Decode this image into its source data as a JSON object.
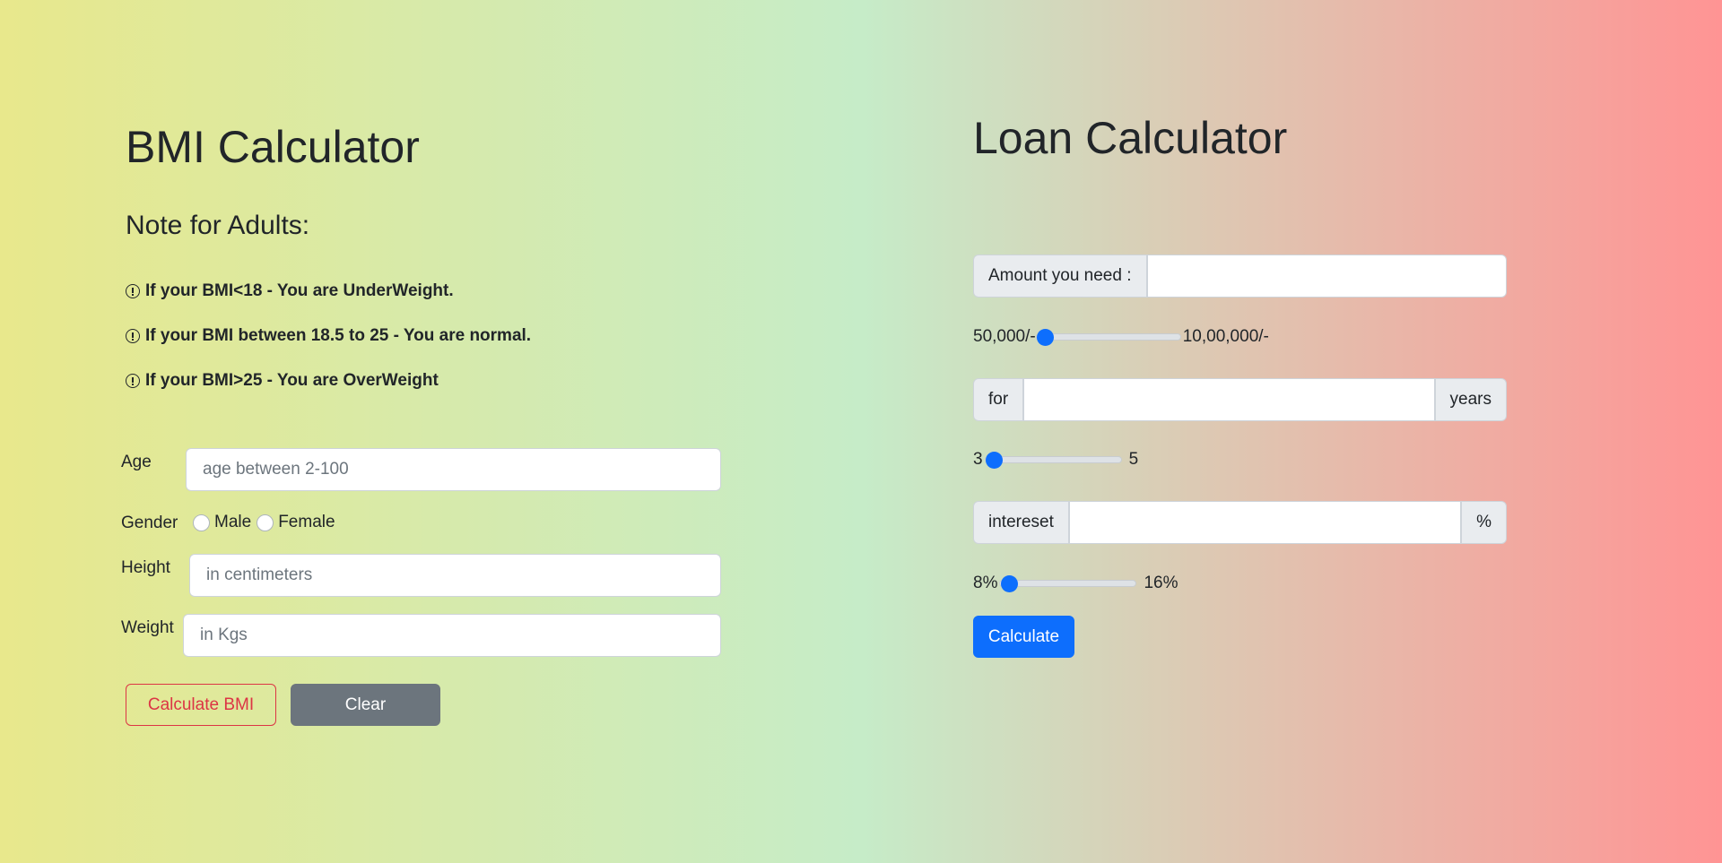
{
  "bmi": {
    "title": "BMI Calculator",
    "note_heading": "Note for Adults:",
    "notes": [
      "If your BMI<18 - You are UnderWeight.",
      "If your BMI between 18.5 to 25 - You are normal.",
      "If your BMI>25 - You are OverWeight"
    ],
    "age_label": "Age",
    "age_placeholder": "age between 2-100",
    "gender_label": "Gender",
    "gender_options": [
      "Male",
      "Female"
    ],
    "height_label": "Height",
    "height_placeholder": "in centimeters",
    "weight_label": "Weight",
    "weight_placeholder": "in Kgs",
    "calculate_label": "Calculate BMI",
    "clear_label": "Clear"
  },
  "loan": {
    "title": "Loan Calculator",
    "amount_label": "Amount you need :",
    "amount_value": "",
    "amount_slider": {
      "min_label": "50,000/-",
      "max_label": "10,00,000/-",
      "value_fraction": 0.0
    },
    "period_prefix": "for",
    "period_suffix": "years",
    "period_value": "",
    "period_slider": {
      "min_label": "3",
      "max_label": "5",
      "value_fraction": 0.0
    },
    "interest_label": "intereset",
    "interest_suffix": "%",
    "interest_value": "",
    "interest_slider": {
      "min_label": "8%",
      "max_label": "16%",
      "value_fraction": 0.0
    },
    "calculate_label": "Calculate"
  },
  "colors": {
    "gradient_left": "#e8e88c",
    "gradient_mid": "#c6ecc8",
    "gradient_right": "#ff9494",
    "primary": "#0d6efd",
    "danger": "#dc3545",
    "secondary": "#6c757d"
  }
}
